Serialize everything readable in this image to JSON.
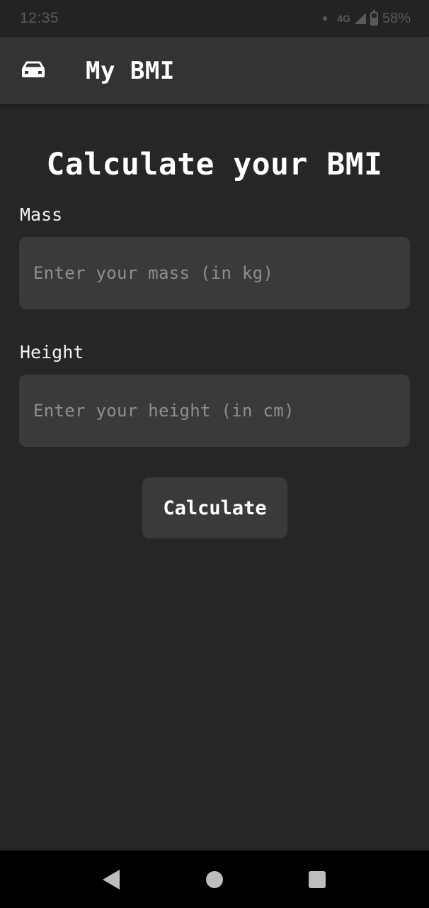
{
  "status_bar": {
    "time": "12:35",
    "network": "4G",
    "battery": "58%"
  },
  "app_bar": {
    "title": "My BMI",
    "icon": "car-front-icon"
  },
  "main": {
    "heading": "Calculate your BMI",
    "mass": {
      "label": "Mass",
      "value": "",
      "placeholder": "Enter your mass (in kg)"
    },
    "height": {
      "label": "Height",
      "value": "",
      "placeholder": "Enter your height (in cm)"
    },
    "calculate_label": "Calculate"
  },
  "nav_bar": {
    "icons": [
      "back-icon",
      "home-icon",
      "recents-icon"
    ]
  },
  "colors": {
    "background": "#262626",
    "app_bar": "#333333",
    "field": "#3a3a3a",
    "text": "#ffffff",
    "placeholder": "#8f8f8f"
  }
}
